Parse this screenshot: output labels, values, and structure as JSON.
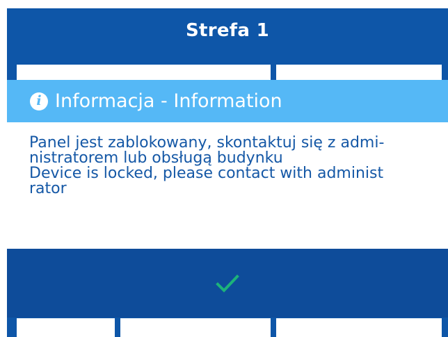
{
  "panel": {
    "title": "Strefa 1"
  },
  "dialog": {
    "icon": "info-icon",
    "title": "Informacja - Information",
    "message_lines": [
      "Panel jest zablokowany, skontaktuj się z admi-",
      "nistratorem lub obsługą budynku",
      "Device is locked, please contact with administ",
      "rator"
    ],
    "confirm_icon": "checkmark-icon"
  },
  "colors": {
    "panel_background": "#0e56a8",
    "dialog_header": "#55b8f6",
    "dialog_footer": "#0e4c9a",
    "message_text": "#1558a6",
    "checkmark": "#1db37a"
  }
}
